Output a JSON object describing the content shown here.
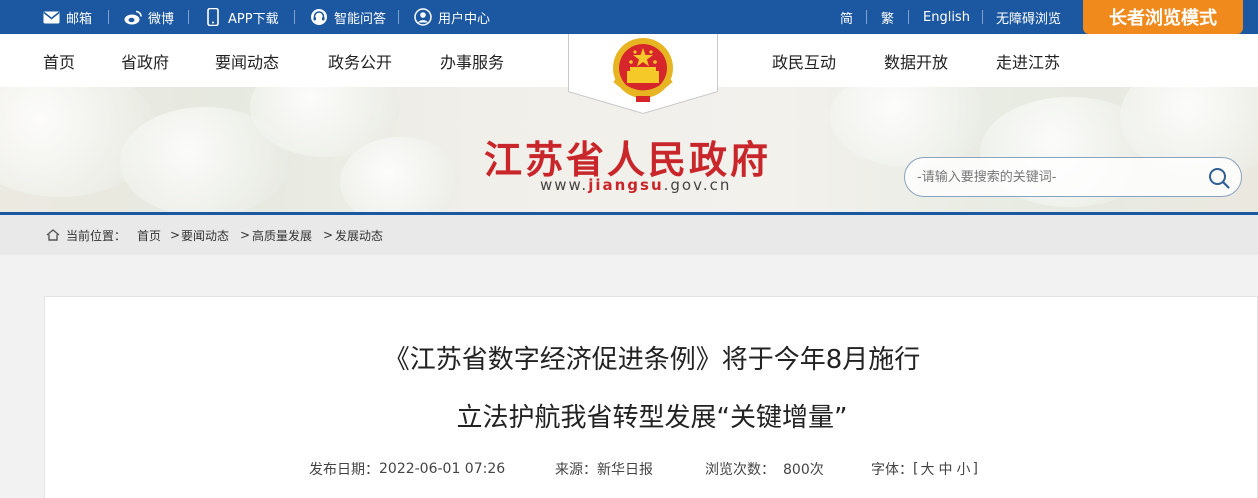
{
  "topbar": {
    "left_items": [
      {
        "label": "邮箱",
        "icon": "mail-icon"
      },
      {
        "label": "微博",
        "icon": "weibo-icon"
      },
      {
        "label": "APP下载",
        "icon": "phone-icon"
      },
      {
        "label": "智能问答",
        "icon": "headset-icon"
      },
      {
        "label": "用户中心",
        "icon": "user-icon"
      }
    ],
    "right_items": [
      "简",
      "繁",
      "English",
      "无障碍浏览"
    ],
    "elder_mode": "长者浏览模式"
  },
  "nav": {
    "left": [
      "首页",
      "省政府",
      "要闻动态",
      "政务公开",
      "办事服务"
    ],
    "right": [
      "政民互动",
      "数据开放",
      "走进江苏"
    ]
  },
  "banner": {
    "title": "江苏省人民政府",
    "domain_prefix": "www.",
    "domain_main": "jiangsu",
    "domain_suffix": ".gov.cn"
  },
  "search": {
    "placeholder": "-请输入要搜索的关键词-"
  },
  "breadcrumb": {
    "label": "当前位置：",
    "items": [
      "首页",
      "要闻动态",
      "高质量发展",
      "发展动态"
    ],
    "separator": ">"
  },
  "article": {
    "title_line1": "《江苏省数字经济促进条例》将于今年8月施行",
    "title_line2": "立法护航我省转型发展“关键增量”",
    "date_label": "发布日期：",
    "date": "2022-06-01 07:26",
    "source_label": "来源：",
    "source": "新华日报",
    "views_label": "浏览次数：",
    "views": "800次",
    "font_label": "字体：",
    "font_open": "[",
    "font_options": [
      "大",
      "中",
      "小"
    ],
    "font_close": "]"
  },
  "colors": {
    "brand_blue": "#1c58a1",
    "title_red": "#c8262a",
    "elder_orange": "#f08a1c"
  }
}
